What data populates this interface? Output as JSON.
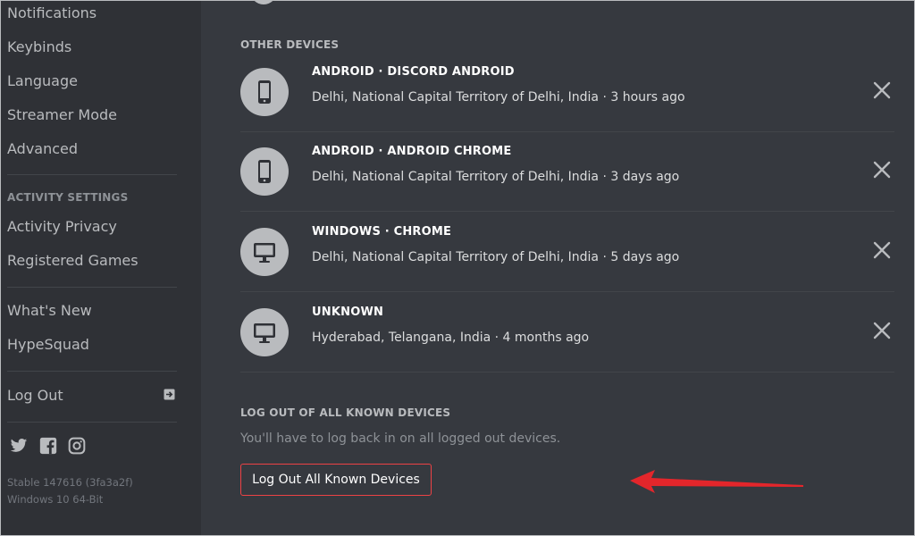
{
  "sidebar": {
    "items_top": [
      "Notifications",
      "Keybinds",
      "Language",
      "Streamer Mode",
      "Advanced"
    ],
    "activity_header": "ACTIVITY SETTINGS",
    "activity_items": [
      "Activity Privacy",
      "Registered Games"
    ],
    "misc_items": [
      "What's New",
      "HypeSquad"
    ],
    "logout_label": "Log Out",
    "version": "Stable 147616 (3fa3a2f)",
    "os": "Windows 10 64-Bit"
  },
  "main": {
    "other_devices_title": "OTHER DEVICES",
    "devices": [
      {
        "name": "ANDROID · DISCORD ANDROID",
        "location": "Delhi, National Capital Territory of Delhi, India · 3 hours ago",
        "icon": "phone-icon"
      },
      {
        "name": "ANDROID · ANDROID CHROME",
        "location": "Delhi, National Capital Territory of Delhi, India · 3 days ago",
        "icon": "phone-icon"
      },
      {
        "name": "WINDOWS · CHROME",
        "location": "Delhi, National Capital Territory of Delhi, India · 5 days ago",
        "icon": "monitor-icon"
      },
      {
        "name": "UNKNOWN",
        "location": "Hyderabad, Telangana, India · 4 months ago",
        "icon": "monitor-icon"
      }
    ],
    "logout_all_title": "LOG OUT OF ALL KNOWN DEVICES",
    "logout_all_hint": "You'll have to log back in on all logged out devices.",
    "logout_all_button": "Log Out All Known Devices"
  },
  "colors": {
    "sidebar_bg": "#2f3136",
    "main_bg": "#36393f",
    "danger": "#ed4245",
    "arrow": "#e3262b"
  }
}
